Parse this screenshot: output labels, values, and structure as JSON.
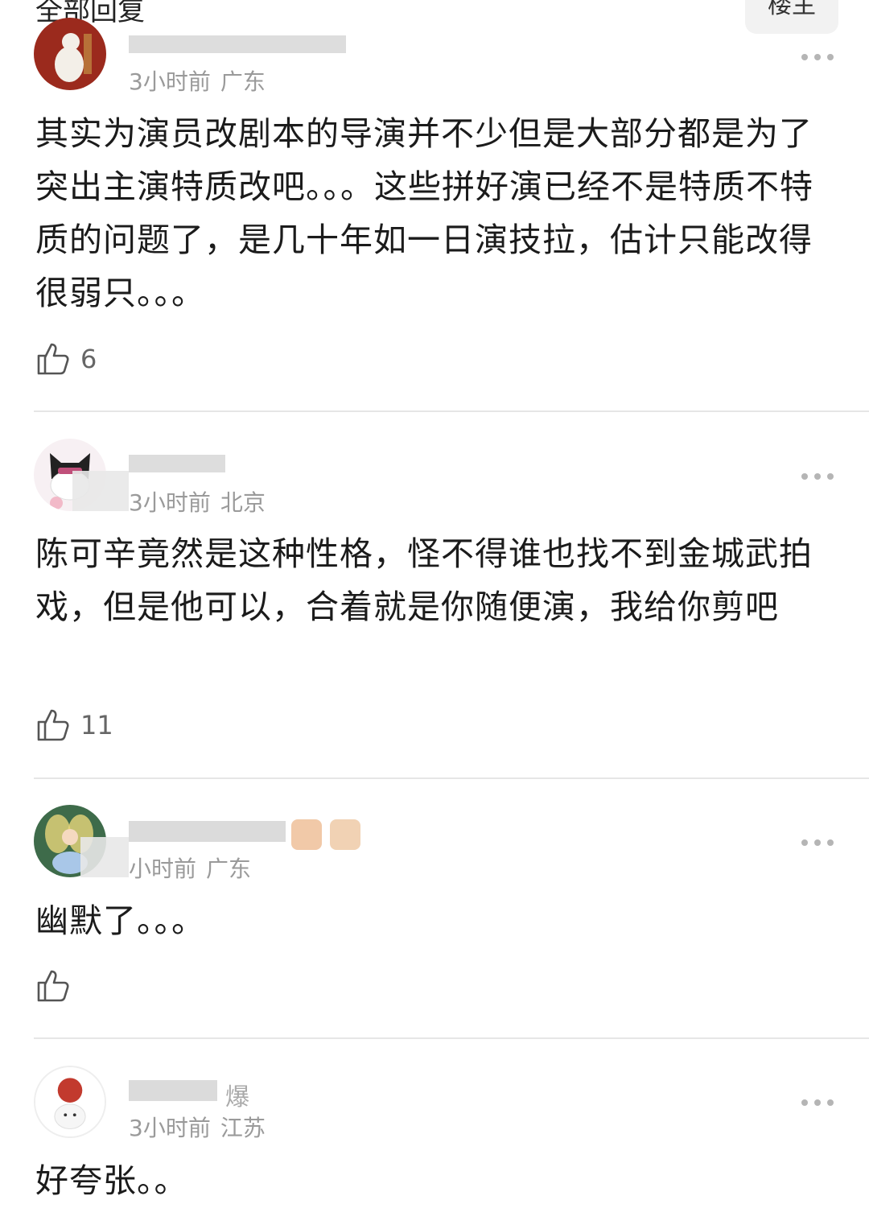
{
  "header": {
    "title": "全部回复",
    "op_button": "楼主"
  },
  "comments": [
    {
      "username": "",
      "time": "3小时前",
      "location": "广东",
      "text": "其实为演员改剧本的导演并不少但是大部分都是为了突出主演特质改吧。。。这些拼好演已经不是特质不特质的问题了，是几十年如一日演技拉，估计只能改得很弱只。。。",
      "likes": "6"
    },
    {
      "username": "",
      "time": "3小时前",
      "location": "北京",
      "text": "陈可辛竟然是这种性格，怪不得谁也找不到金城武拍戏，但是他可以，合着就是你随便演，我给你剪吧",
      "likes": "11"
    },
    {
      "username": "",
      "time": "小时前",
      "location": "广东",
      "text": "幽默了。。。",
      "likes": ""
    },
    {
      "username": "爆",
      "time": "3小时前",
      "location": "江苏",
      "text": "好夸张。。",
      "likes": ""
    }
  ],
  "icons": {
    "more": "more-horizontal-icon",
    "like": "thumbs-up-icon"
  },
  "colors": {
    "text": "#1b1b1b",
    "meta": "#9a9a9a",
    "divider": "#e6e6e6",
    "button_bg": "#f2f2f2"
  }
}
